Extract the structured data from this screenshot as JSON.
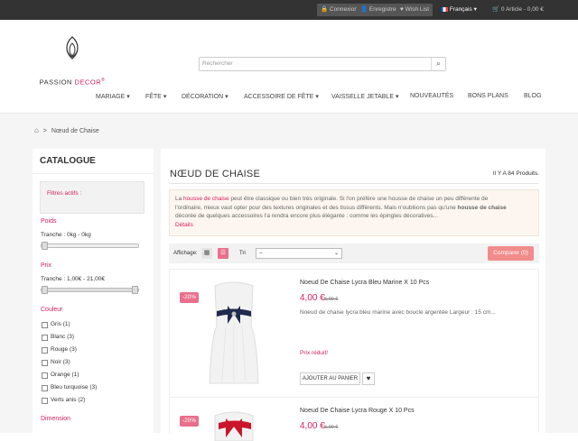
{
  "topbar": {
    "login": "Connexion",
    "register": "Enregistrer",
    "wishlist": "Wish List",
    "language": "Français",
    "cart": "0 Article - 0,00 €"
  },
  "logo": {
    "word1": "PASSION ",
    "word2": "DECOR",
    "reg": "®"
  },
  "search": {
    "placeholder": "Rechercher"
  },
  "menu": [
    "MARIAGE",
    "FÊTE",
    "DÉCORATION",
    "ACCESSOIRE DE FÊTE",
    "VAISSELLE JETABLE",
    "NOUVEAUTÉS",
    "BONS PLANS",
    "BLOG"
  ],
  "breadcrumb": {
    "sep": ">",
    "current": "Nœud de Chaise"
  },
  "sidebar": {
    "title": "CATALOGUE",
    "active_filters": "Filtres actifs :",
    "weight": {
      "label": "Poids",
      "range": "Tranche : 0kg - 0kg"
    },
    "price": {
      "label": "Prix",
      "range": "Tranche : 1,00€ - 21,00€"
    },
    "color": {
      "label": "Couleur",
      "options": [
        "Gris (1)",
        "Blanc (3)",
        "Rouge (3)",
        "Noir (3)",
        "Orange (1)",
        "Bleu turquoise (3)",
        "Verts anis (2)"
      ]
    },
    "dimension": {
      "label": "Dimension"
    }
  },
  "category": {
    "title": "NŒUD DE CHAISE",
    "count": "Il Y A 84 Produits.",
    "desc_lines": [
      [
        "La ",
        "housse de chaise",
        " peut être classique ou bien très originale. Si l'on préfère une housse de chaise un peu différente de"
      ],
      [
        "l'ordinaire, mieux vaut opter pour des textures originales et des tissus différents. Mais n'oubliions pas qu'une ",
        "housse de chaise"
      ],
      [
        "décorée de quelques accessoires l'a rendra encore plus élégante : comme les épingles décoratives..."
      ],
      [
        "Détails"
      ]
    ]
  },
  "toolbar": {
    "display": "Affichage:",
    "sort": "Tri",
    "sort_value": "--",
    "compare": "Comparer (0)"
  },
  "products": [
    {
      "discount": "-20%",
      "name": "Noeud De Chaise Lycra Bleu Marine X 10 Pcs",
      "price": "4,00 €",
      "old_price": "5,00 €",
      "desc": "Noeud de chaise lycra bleu marine avec boucle argentée  Largeur : 15 cm...",
      "reduced": "Prix réduit!",
      "add": "AJOUTER AU PANIER",
      "bow_color": "#1f2a4e"
    },
    {
      "discount": "-20%",
      "name": "Noeud De Chaise Lycra Rouge X 10 Pcs",
      "price": "4,00 €",
      "old_price": "5,00 €",
      "bow_color": "#c9162a"
    }
  ],
  "colors": {
    "accent": "#d5215e",
    "topbar": "#333333",
    "compare": "#f28b8b"
  },
  "icons": [
    "lock-icon",
    "user-icon",
    "heart-icon",
    "flag-fr-icon",
    "cart-icon",
    "search-icon",
    "home-icon",
    "grid-icon",
    "list-icon"
  ]
}
